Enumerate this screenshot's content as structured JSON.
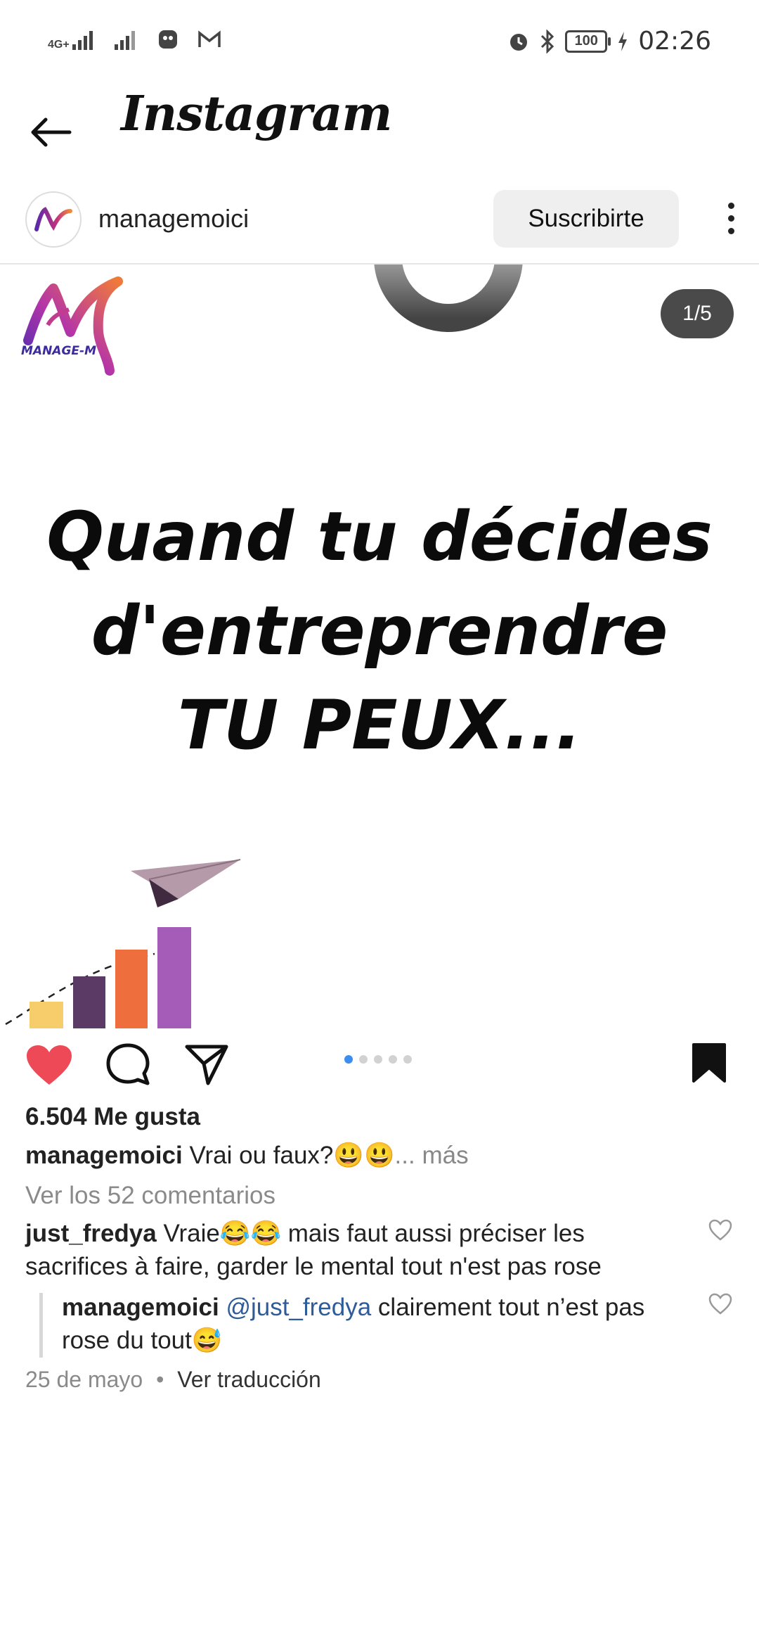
{
  "status_bar": {
    "network": "4G+",
    "time": "02:26",
    "battery": "100"
  },
  "app": {
    "title": "Instagram"
  },
  "post_header": {
    "username": "managemoici",
    "subscribe_label": "Suscribirte"
  },
  "post": {
    "slide_counter": "1/5",
    "brand_text": "MANAGE-MOI",
    "headline_lines": [
      "Quand tu décides",
      "d'entreprendre",
      "TU PEUX..."
    ],
    "slides_total": 5,
    "active_slide": 1,
    "colors": {
      "bar1": "#f6cd6a",
      "bar2": "#5b3a66",
      "bar3": "#ee6e3d",
      "bar4": "#a55bb8",
      "plane": "#b59aaa",
      "liked_heart": "#ed4956"
    }
  },
  "actions": {
    "icons": [
      "heart-icon",
      "comment-icon",
      "share-icon",
      "bookmark-icon"
    ]
  },
  "engagement": {
    "likes": "6.504 Me gusta",
    "caption_user": "managemoici",
    "caption_text": "Vrai ou faux?😃😃",
    "caption_more_label": "... más",
    "view_comments_label": "Ver los 52 comentarios"
  },
  "comments": [
    {
      "user": "just_fredya",
      "text": "Vraie😂😂 mais faut aussi préciser les sacrifices à faire, garder le mental tout n'est pas rose"
    }
  ],
  "reply": {
    "user": "managemoici",
    "mention": "@just_fredya",
    "text": "clairement tout n’est pas rose du tout😅"
  },
  "meta": {
    "date": "25 de mayo",
    "separator": "•",
    "translate_label": "Ver traducción"
  }
}
